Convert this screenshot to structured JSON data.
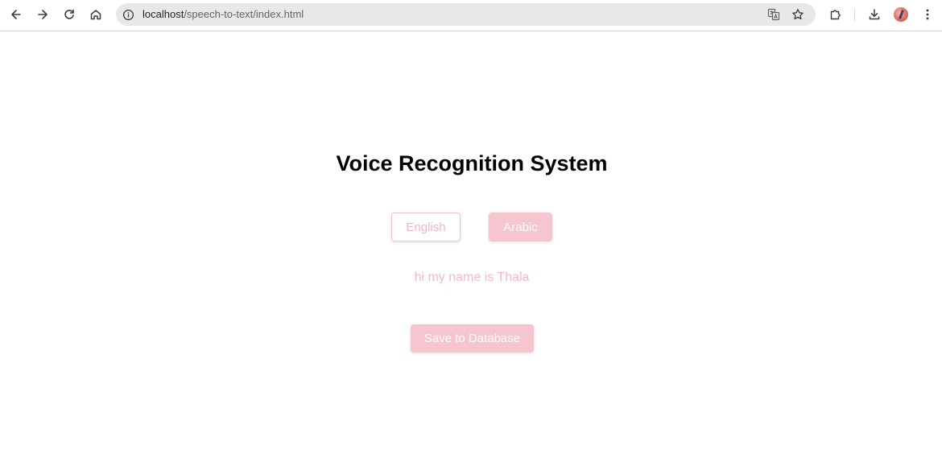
{
  "browser": {
    "url_host": "localhost",
    "url_path": "/speech-to-text/index.html",
    "icons": {
      "back": "back-arrow-icon",
      "forward": "forward-arrow-icon",
      "reload": "reload-icon",
      "home": "home-icon",
      "site_info": "info-icon",
      "translate": "translate-icon",
      "bookmark": "star-icon",
      "extensions": "puzzle-icon",
      "downloads": "download-icon",
      "menu": "kebab-menu-icon"
    }
  },
  "page": {
    "title": "Voice Recognition System",
    "language_buttons": {
      "english": "English",
      "arabic": "Arabic"
    },
    "transcript": "hi my name is Thala",
    "save_button": "Save to Database"
  },
  "colors": {
    "accent_pink": "#f7c5cf",
    "pink_text": "#f3b9c5"
  }
}
